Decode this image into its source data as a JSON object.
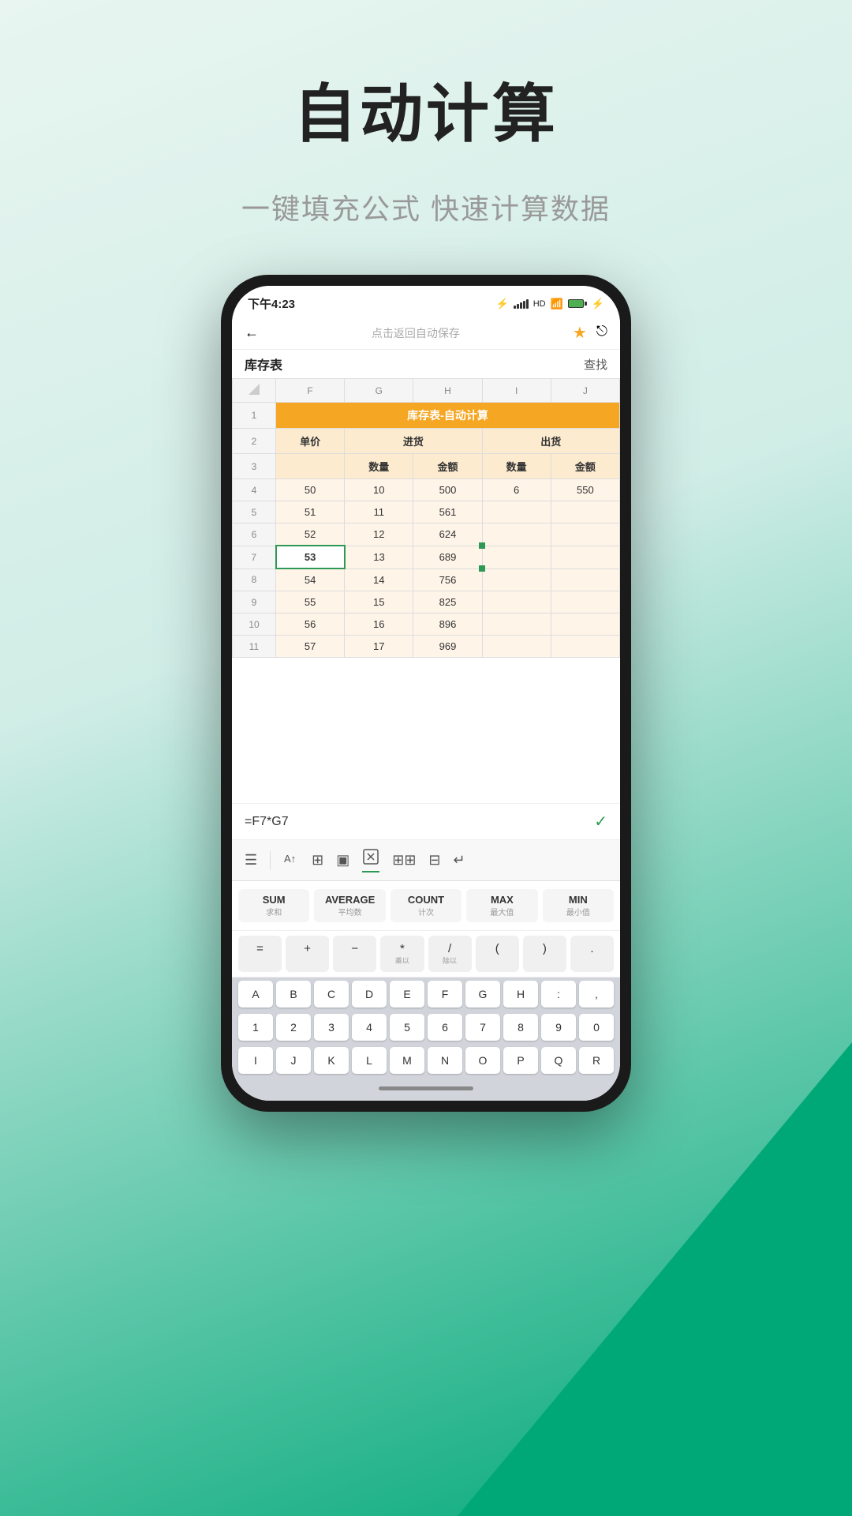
{
  "page": {
    "main_title": "自动计算",
    "sub_title": "一键填充公式 快速计算数据"
  },
  "status_bar": {
    "time": "下午4:23",
    "nav_title": "点击返回自动保存"
  },
  "toolbar": {
    "sheet_name": "库存表",
    "action": "查找"
  },
  "spreadsheet": {
    "title_cell": "库存表-自动计算",
    "col_headers": [
      "F",
      "G",
      "H",
      "I",
      "J"
    ],
    "row2": [
      "单价",
      "进货",
      "",
      "出货",
      ""
    ],
    "row3": [
      "",
      "数量",
      "金额",
      "数量",
      "金额"
    ],
    "rows": [
      {
        "row": 4,
        "f": "50",
        "g": "10",
        "h": "500",
        "i": "6",
        "j": "550"
      },
      {
        "row": 5,
        "f": "51",
        "g": "11",
        "h": "561",
        "i": "",
        "j": ""
      },
      {
        "row": 6,
        "f": "52",
        "g": "12",
        "h": "624",
        "i": "",
        "j": ""
      },
      {
        "row": 7,
        "f": "53",
        "g": "13",
        "h": "689",
        "i": "",
        "j": "",
        "selected_f": true
      },
      {
        "row": 8,
        "f": "54",
        "g": "14",
        "h": "756",
        "i": "",
        "j": ""
      },
      {
        "row": 9,
        "f": "55",
        "g": "15",
        "h": "825",
        "i": "",
        "j": ""
      },
      {
        "row": 10,
        "f": "56",
        "g": "16",
        "h": "896",
        "i": "",
        "j": ""
      },
      {
        "row": 11,
        "f": "57",
        "g": "17",
        "h": "969",
        "i": "",
        "j": ""
      }
    ]
  },
  "formula_bar": {
    "formula": "=F7*G7"
  },
  "kb_toolbar": {
    "icons": [
      "☰",
      "A↑",
      "⊞",
      "▣",
      "⊡",
      "⊞⊞",
      "⊟",
      "↵"
    ]
  },
  "functions": [
    {
      "main": "SUM",
      "sub": "求和"
    },
    {
      "main": "AVERAGE",
      "sub": "平均数"
    },
    {
      "main": "COUNT",
      "sub": "计次"
    },
    {
      "main": "MAX",
      "sub": "最大值"
    },
    {
      "main": "MIN",
      "sub": "最小值"
    }
  ],
  "operators": [
    {
      "label": "="
    },
    {
      "label": "+"
    },
    {
      "label": "-"
    },
    {
      "label": "*",
      "sub": "乘以"
    },
    {
      "label": "/",
      "sub": "除以"
    },
    {
      "label": "("
    },
    {
      "label": ")"
    },
    {
      "label": "."
    }
  ],
  "alpha_rows": [
    [
      "A",
      "B",
      "C",
      "D",
      "E",
      "F",
      "G",
      "H",
      ":",
      ","
    ],
    [
      "I",
      "J",
      "K",
      "L",
      "M",
      "N",
      "O",
      "P",
      "Q",
      "R"
    ]
  ],
  "num_row": [
    "1",
    "2",
    "3",
    "4",
    "5",
    "6",
    "7",
    "8",
    "9",
    "0"
  ]
}
